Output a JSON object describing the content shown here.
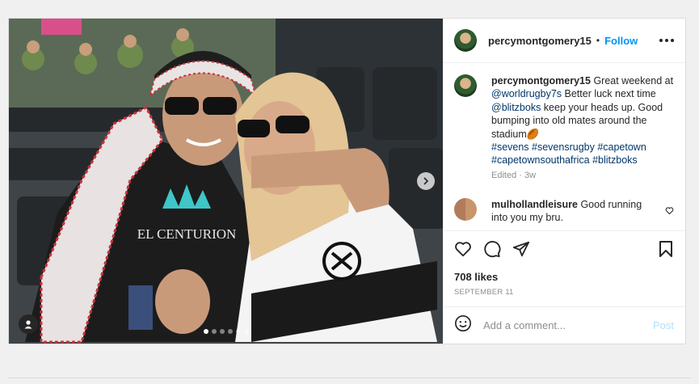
{
  "post": {
    "username": "percymontgomery15",
    "separator": "•",
    "follow_label": "Follow",
    "caption": {
      "username": "percymontgomery15",
      "t1": " Great weekend at ",
      "m1": "@worldrugby7s",
      "t2": " Better luck next time ",
      "m2": "@blitzboks",
      "t3": " keep your heads up. Good bumping into old mates around the stadium🏉",
      "hashtags": "#sevens #sevensrugby #capetown #capetownsouthafrica #blitzboks"
    },
    "edited_label": "Edited",
    "edited_time": "3w",
    "comments": [
      {
        "username": "mulhollandleisure",
        "text": " Good running into you my bru."
      }
    ],
    "likes": "708 likes",
    "date": "SEPTEMBER 11",
    "add_comment_placeholder": "Add a comment...",
    "post_button": "Post",
    "shirt_brand": "EL CENTURION"
  },
  "carousel": {
    "count": 6,
    "active_index": 0
  },
  "colors": {
    "accent": "#0095f6",
    "text": "#262626",
    "muted": "#8e8e8e"
  },
  "icons": [
    "more-icon",
    "heart-icon",
    "comment-icon",
    "share-icon",
    "save-icon",
    "emoji-icon",
    "user-tag-icon",
    "next-arrow-icon"
  ]
}
